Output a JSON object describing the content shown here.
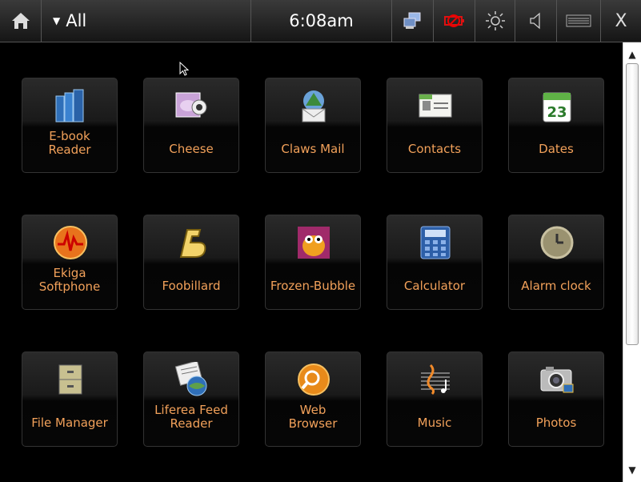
{
  "topbar": {
    "category": "All",
    "time": "6:08am",
    "close_glyph": "X",
    "icons": [
      "home-icon",
      "network-icon",
      "battery-icon",
      "brightness-icon",
      "volume-icon",
      "keyboard-icon",
      "close-icon"
    ]
  },
  "apps": [
    {
      "lines": [
        "E-book",
        "Reader"
      ],
      "icon": "ebook-icon"
    },
    {
      "lines": [
        "Cheese"
      ],
      "icon": "cheese-icon"
    },
    {
      "lines": [
        "Claws Mail"
      ],
      "icon": "claws-mail-icon"
    },
    {
      "lines": [
        "Contacts"
      ],
      "icon": "contacts-icon"
    },
    {
      "lines": [
        "Dates"
      ],
      "icon": "dates-icon",
      "icon_text": "23"
    },
    {
      "lines": [
        "Ekiga",
        "Softphone"
      ],
      "icon": "ekiga-icon"
    },
    {
      "lines": [
        "Foobillard"
      ],
      "icon": "foobillard-icon"
    },
    {
      "lines": [
        "Frozen-Bubble"
      ],
      "icon": "frozen-bubble-icon"
    },
    {
      "lines": [
        "Calculator"
      ],
      "icon": "calculator-icon"
    },
    {
      "lines": [
        "Alarm clock"
      ],
      "icon": "alarm-clock-icon"
    },
    {
      "lines": [
        "File Manager"
      ],
      "icon": "file-manager-icon"
    },
    {
      "lines": [
        "Liferea Feed",
        "Reader"
      ],
      "icon": "liferea-icon"
    },
    {
      "lines": [
        "Web",
        "Browser"
      ],
      "icon": "web-browser-icon"
    },
    {
      "lines": [
        "Music"
      ],
      "icon": "music-icon"
    },
    {
      "lines": [
        "Photos"
      ],
      "icon": "photos-icon"
    }
  ],
  "colors": {
    "label": "#f2a15a",
    "background": "#000000",
    "tile_top": "#2a2a2a"
  }
}
